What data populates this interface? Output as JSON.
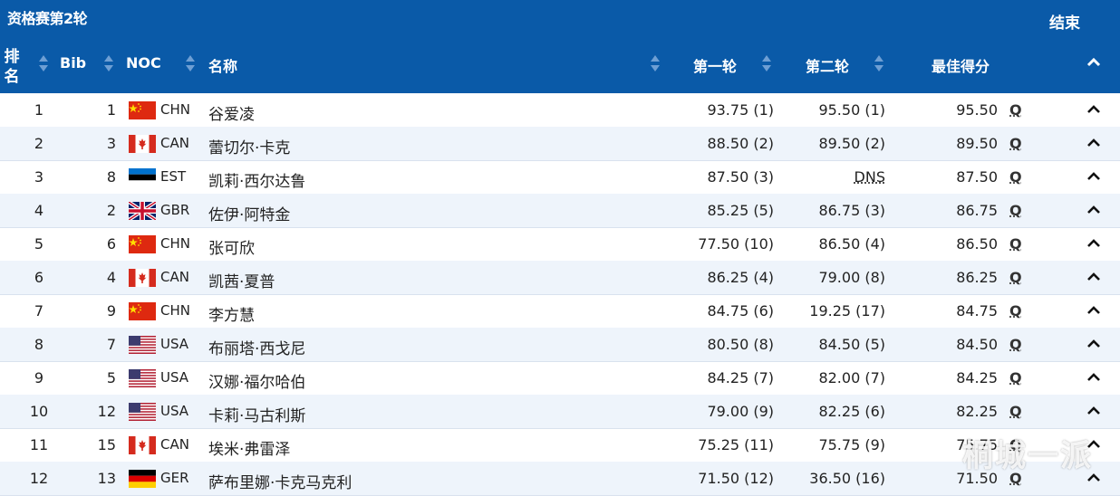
{
  "header": {
    "title": "资格赛第2轮",
    "status": "结束",
    "columns": {
      "rank": "排名",
      "bib": "Bib",
      "noc": "NOC",
      "name": "名称",
      "run1": "第一轮",
      "run2": "第二轮",
      "best": "最佳得分"
    }
  },
  "rows": [
    {
      "rank": "1",
      "bib": "1",
      "flag": "chn",
      "noc": "CHN",
      "name": "谷爱凌",
      "run1": "93.75 (1)",
      "run2": "95.50 (1)",
      "best": "95.50",
      "q": "Q"
    },
    {
      "rank": "2",
      "bib": "3",
      "flag": "can",
      "noc": "CAN",
      "name": "蕾切尔·卡克",
      "run1": "88.50 (2)",
      "run2": "89.50 (2)",
      "best": "89.50",
      "q": "Q"
    },
    {
      "rank": "3",
      "bib": "8",
      "flag": "est",
      "noc": "EST",
      "name": "凯莉·西尔达鲁",
      "run1": "87.50 (3)",
      "run2": "DNS",
      "best": "87.50",
      "q": "Q"
    },
    {
      "rank": "4",
      "bib": "2",
      "flag": "gbr",
      "noc": "GBR",
      "name": "佐伊·阿特金",
      "run1": "85.25 (5)",
      "run2": "86.75 (3)",
      "best": "86.75",
      "q": "Q"
    },
    {
      "rank": "5",
      "bib": "6",
      "flag": "chn",
      "noc": "CHN",
      "name": "张可欣",
      "run1": "77.50 (10)",
      "run2": "86.50 (4)",
      "best": "86.50",
      "q": "Q"
    },
    {
      "rank": "6",
      "bib": "4",
      "flag": "can",
      "noc": "CAN",
      "name": "凯茜·夏普",
      "run1": "86.25 (4)",
      "run2": "79.00 (8)",
      "best": "86.25",
      "q": "Q"
    },
    {
      "rank": "7",
      "bib": "9",
      "flag": "chn",
      "noc": "CHN",
      "name": "李方慧",
      "run1": "84.75 (6)",
      "run2": "19.25 (17)",
      "best": "84.75",
      "q": "Q"
    },
    {
      "rank": "8",
      "bib": "7",
      "flag": "usa",
      "noc": "USA",
      "name": "布丽塔·西戈尼",
      "run1": "80.50 (8)",
      "run2": "84.50 (5)",
      "best": "84.50",
      "q": "Q"
    },
    {
      "rank": "9",
      "bib": "5",
      "flag": "usa",
      "noc": "USA",
      "name": "汉娜·福尔哈伯",
      "run1": "84.25 (7)",
      "run2": "82.00 (7)",
      "best": "84.25",
      "q": "Q"
    },
    {
      "rank": "10",
      "bib": "12",
      "flag": "usa",
      "noc": "USA",
      "name": "卡莉·马古利斯",
      "run1": "79.00 (9)",
      "run2": "82.25 (6)",
      "best": "82.25",
      "q": "Q"
    },
    {
      "rank": "11",
      "bib": "15",
      "flag": "can",
      "noc": "CAN",
      "name": "埃米·弗雷泽",
      "run1": "75.25 (11)",
      "run2": "75.75 (9)",
      "best": "75.75",
      "q": "Q"
    },
    {
      "rank": "12",
      "bib": "13",
      "flag": "ger",
      "noc": "GER",
      "name": "萨布里娜·卡克马克利",
      "run1": "71.50 (12)",
      "run2": "36.50 (16)",
      "best": "71.50",
      "q": "Q"
    }
  ],
  "watermark": "桐城一派",
  "colors": {
    "header_bg": "#0a5aa8",
    "alt_row": "#eef4fb"
  }
}
